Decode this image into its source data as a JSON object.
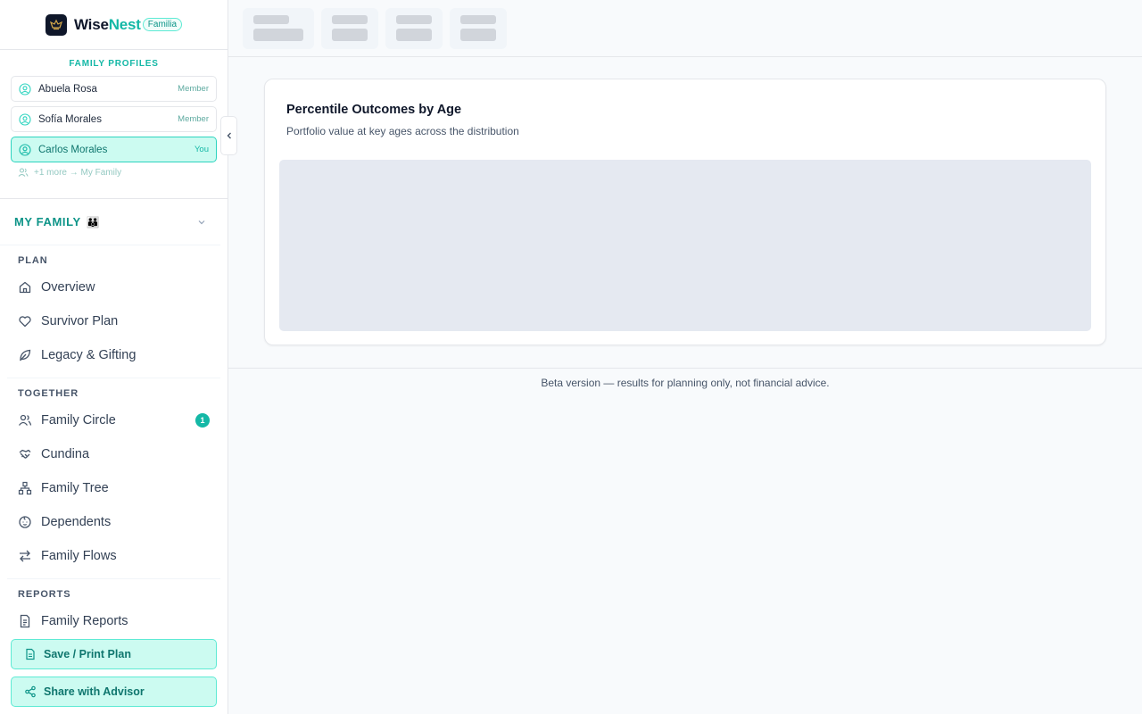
{
  "brand": {
    "name_part1": "Wise",
    "name_part2": "Nest",
    "badge": "Familia",
    "accent": "#14b8a6"
  },
  "profiles": {
    "title": "FAMILY PROFILES",
    "items": [
      {
        "name": "Abuela Rosa",
        "role": "Member",
        "active": false
      },
      {
        "name": "Sofía Morales",
        "role": "Member",
        "active": false
      },
      {
        "name": "Carlos Morales",
        "role": "You",
        "active": true
      }
    ],
    "more_text": "+1 more → My Family"
  },
  "family_selector": {
    "label": "MY FAMILY",
    "emoji": "👪"
  },
  "nav": {
    "sections": [
      {
        "title": "PLAN",
        "items": [
          {
            "label": "Overview",
            "icon": "home-icon"
          },
          {
            "label": "Survivor Plan",
            "icon": "heart-icon"
          },
          {
            "label": "Legacy & Gifting",
            "icon": "leaf-icon"
          }
        ]
      },
      {
        "title": "TOGETHER",
        "items": [
          {
            "label": "Family Circle",
            "icon": "users-icon",
            "count": "1"
          },
          {
            "label": "Cundina",
            "icon": "handshake-icon"
          },
          {
            "label": "Family Tree",
            "icon": "tree-icon"
          },
          {
            "label": "Dependents",
            "icon": "baby-icon"
          },
          {
            "label": "Family Flows",
            "icon": "arrows-icon"
          }
        ]
      },
      {
        "title": "REPORTS",
        "items": [
          {
            "label": "Family Reports",
            "icon": "document-icon"
          }
        ]
      }
    ]
  },
  "actions": {
    "save_label": "Save / Print Plan",
    "share_label": "Share with Advisor"
  },
  "card": {
    "title": "Percentile Outcomes by Age",
    "subtitle": "Portfolio value at key ages across the distribution"
  },
  "footer": {
    "text": "Beta version — results for planning only, not financial advice."
  }
}
